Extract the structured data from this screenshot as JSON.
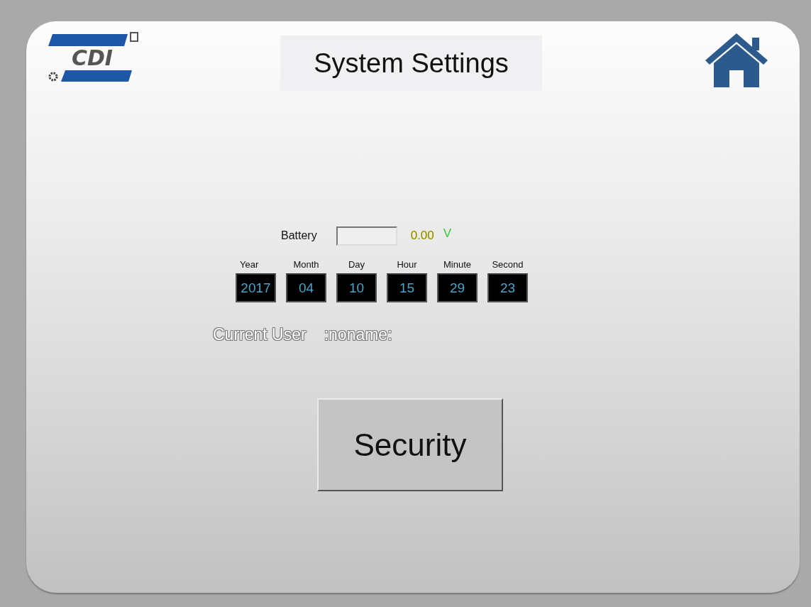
{
  "logo": {
    "text": "CDI"
  },
  "title": "System Settings",
  "battery": {
    "label": "Battery",
    "value": "0.00",
    "unit": "V"
  },
  "datetime": [
    {
      "label": "Year",
      "value": "2017"
    },
    {
      "label": "Month",
      "value": "04"
    },
    {
      "label": "Day",
      "value": "10"
    },
    {
      "label": "Hour",
      "value": "15"
    },
    {
      "label": "Minute",
      "value": "29"
    },
    {
      "label": "Second",
      "value": "23"
    }
  ],
  "current_user": {
    "label": "Current User",
    "value": ":noname:"
  },
  "buttons": [
    {
      "label": "Security"
    }
  ]
}
